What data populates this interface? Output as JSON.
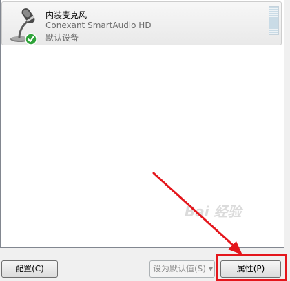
{
  "device": {
    "name": "内装麦克风",
    "driver": "Conexant SmartAudio HD",
    "status": "默认设备",
    "icon": "microphone-icon",
    "status_icon": "check-icon"
  },
  "buttons": {
    "configure": "配置(C)",
    "set_default": "设为默认值(S)",
    "set_default_arrow": "▼",
    "properties": "属性(P)"
  },
  "watermark": "Bai 经验",
  "colors": {
    "highlight": "#e4161c",
    "check_green": "#2fa33a"
  }
}
